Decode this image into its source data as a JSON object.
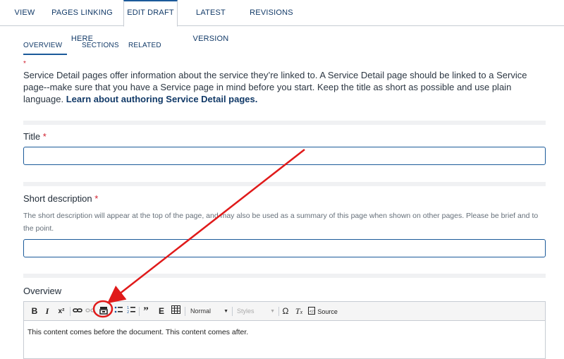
{
  "top_tabs": [
    {
      "label": "VIEW"
    },
    {
      "label": "PAGES LINKING HERE"
    },
    {
      "label": "EDIT DRAFT"
    },
    {
      "label": "LATEST VERSION"
    },
    {
      "label": "REVISIONS"
    }
  ],
  "sub_tabs": [
    {
      "label": "OVERVIEW",
      "required": "*"
    },
    {
      "label": "SECTIONS"
    },
    {
      "label": "RELATED"
    }
  ],
  "intro": {
    "text": "Service Detail pages offer information about the service they’re linked to. A Service Detail page should be linked to a Service page--make sure that you have a Service page in mind before you start. Keep the title as short as possible and use plain language. ",
    "link": "Learn about authoring Service Detail pages."
  },
  "fields": {
    "title": {
      "label": "Title",
      "required": "*",
      "value": ""
    },
    "short_description": {
      "label": "Short description",
      "required": "*",
      "help": "The short description will appear at the top of the page, and may also be used as a summary of this page when shown on other pages. Please be brief and to the point.",
      "value": ""
    },
    "overview": {
      "label": "Overview"
    }
  },
  "editor": {
    "toolbar": {
      "bold": "B",
      "italic": "I",
      "superscript": "x²",
      "quote": "99",
      "embed": "E",
      "format": "Normal",
      "styles": "Styles",
      "omega": "Ω",
      "clear_format": "Tx",
      "source": "Source"
    },
    "content": "This content comes before the document. This content comes after."
  },
  "colors": {
    "accent": "#1b5a9a",
    "required": "#d0202f",
    "annotation": "#e01a1a"
  }
}
